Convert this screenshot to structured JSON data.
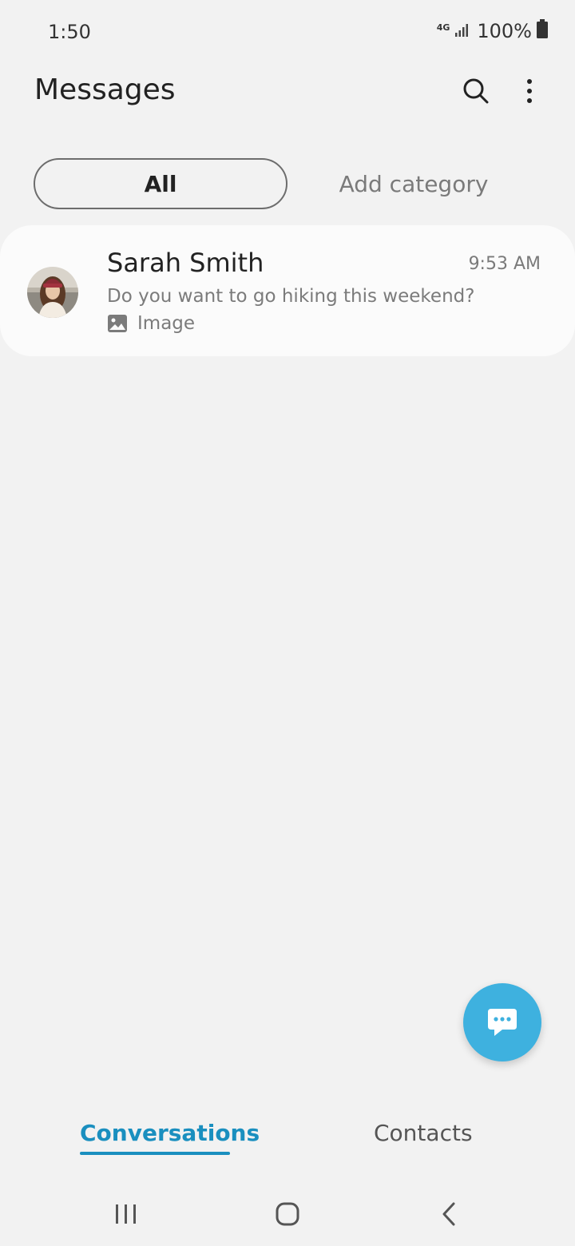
{
  "status_bar": {
    "time": "1:50",
    "network": "4G",
    "battery": "100%"
  },
  "header": {
    "title": "Messages",
    "search_icon": "search-icon",
    "more_icon": "more-vertical-icon"
  },
  "categories": {
    "all_label": "All",
    "add_label": "Add category"
  },
  "conversations": [
    {
      "name": "Sarah Smith",
      "time": "9:53 AM",
      "snippet": "Do you want to go hiking this weekend?",
      "attachment_label": "Image",
      "attachment_icon": "image-icon"
    }
  ],
  "fab": {
    "icon": "chat-bubble-icon",
    "color": "#3eb1df"
  },
  "tabs": {
    "conversations_label": "Conversations",
    "contacts_label": "Contacts",
    "active_color": "#1a8fbf"
  },
  "nav": {
    "recents_icon": "recents-icon",
    "home_icon": "home-icon",
    "back_icon": "back-icon"
  }
}
